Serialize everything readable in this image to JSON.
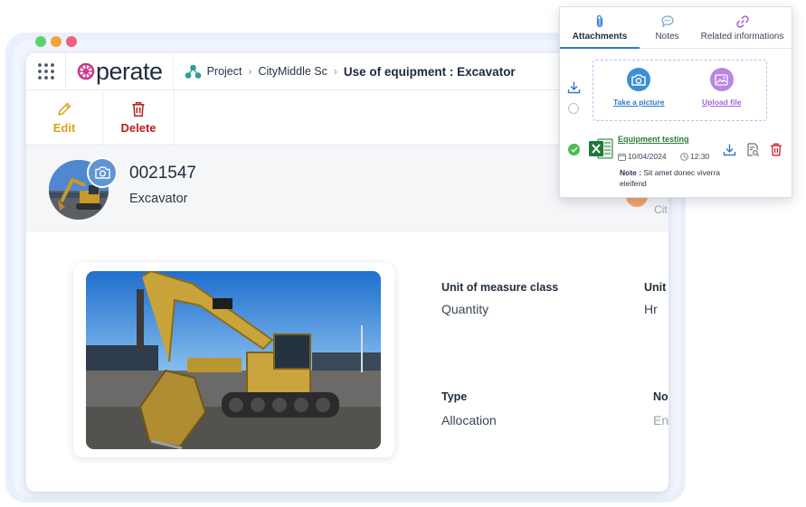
{
  "window": {
    "dot_colors": [
      "#5bd16f",
      "#f4a338",
      "#f2607a"
    ]
  },
  "app": {
    "logo_text": "perate",
    "brand_color": "#c83a8c"
  },
  "breadcrumb": {
    "items": [
      "Project",
      "CityMiddle Sc"
    ],
    "current": "Use of equipment :  Excavator"
  },
  "toolbar": {
    "edit_label": "Edit",
    "delete_label": "Delete",
    "edit_color": "#d9a21b",
    "delete_color": "#b81f1f"
  },
  "equipment": {
    "code": "0021547",
    "name": "Excavator",
    "side_text": "Cit"
  },
  "fields": [
    {
      "label": "Unit of measure class",
      "value": "Quantity"
    },
    {
      "label": "Unit",
      "value": "Hr"
    },
    {
      "label": "Type",
      "value": "Allocation"
    },
    {
      "label": "No",
      "value": "En"
    }
  ],
  "panel": {
    "tabs": [
      "Attachments",
      "Notes",
      "Related informations"
    ],
    "active_tab": "Attachments",
    "take_picture_label": "Take a picture",
    "upload_file_label": "Upload file",
    "attachment": {
      "title": "Equipment testing",
      "date": "10/04/2024",
      "time": "12:30",
      "note_label": "Note :",
      "note_text": "Sit amet donec viverra eleifend"
    }
  }
}
